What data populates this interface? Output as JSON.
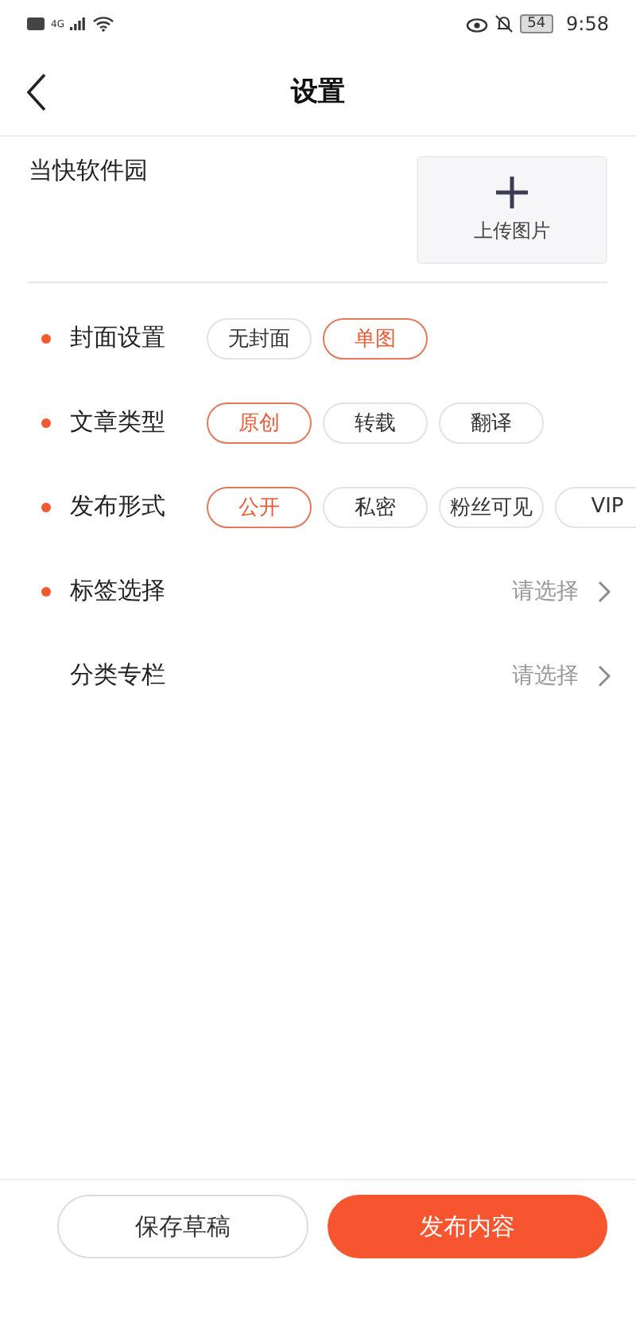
{
  "status_bar": {
    "network": "4G",
    "battery": "54",
    "time": "9:58"
  },
  "header": {
    "title": "设置"
  },
  "article": {
    "title": "当快软件园",
    "upload_label": "上传图片"
  },
  "rows": [
    {
      "kind": "chips",
      "label": "封面设置",
      "required": true,
      "options": [
        {
          "label": "无封面",
          "selected": false
        },
        {
          "label": "单图",
          "selected": true
        }
      ]
    },
    {
      "kind": "chips",
      "label": "文章类型",
      "required": true,
      "options": [
        {
          "label": "原创",
          "selected": true
        },
        {
          "label": "转载",
          "selected": false
        },
        {
          "label": "翻译",
          "selected": false
        }
      ]
    },
    {
      "kind": "chips",
      "label": "发布形式",
      "required": true,
      "options": [
        {
          "label": "公开",
          "selected": true
        },
        {
          "label": "私密",
          "selected": false
        },
        {
          "label": "粉丝可见",
          "selected": false
        },
        {
          "label": "VIP",
          "selected": false
        }
      ]
    },
    {
      "kind": "select",
      "label": "标签选择",
      "required": true,
      "placeholder": "请选择"
    },
    {
      "kind": "select",
      "label": "分类专栏",
      "required": false,
      "placeholder": "请选择"
    }
  ],
  "buttons": {
    "draft": "保存草稿",
    "publish": "发布内容"
  }
}
